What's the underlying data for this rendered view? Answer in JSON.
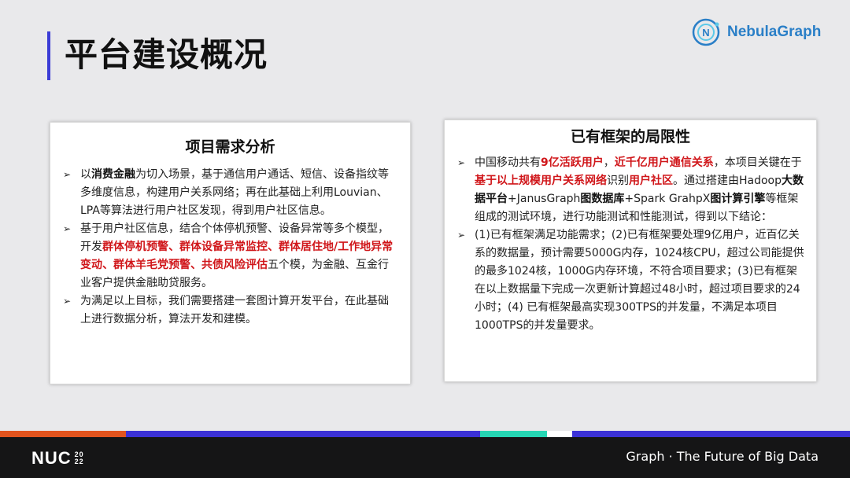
{
  "header": {
    "title": "平台建设概况"
  },
  "logo": {
    "text": "NebulaGraph",
    "icon": "nebula-logo-icon",
    "color": "#2a7fc7"
  },
  "left_panel": {
    "title": "项目需求分析",
    "items": [
      {
        "segments": [
          {
            "text": "以",
            "style": "normal"
          },
          {
            "text": "消费金融",
            "style": "bold"
          },
          {
            "text": "为切入场景，基于通信用户通话、短信、设备指纹等多维度信息，构建用户关系网络；再在此基础上利用Louvian、LPA等算法进行用户社区发现，得到用户社区信息。",
            "style": "normal"
          }
        ]
      },
      {
        "segments": [
          {
            "text": "基于用户社区信息，结合个体停机预警、设备异常等多个模型，开发",
            "style": "normal"
          },
          {
            "text": "群体停机预警、群体设备异常监控、群体居住地/工作地异常变动、群体羊毛党预警、共债风险评估",
            "style": "red"
          },
          {
            "text": "五个模，为金融、互金行业客户提供金融助贷服务。",
            "style": "normal"
          }
        ]
      },
      {
        "segments": [
          {
            "text": "为满足以上目标，我们需要搭建一套图计算开发平台，在此基础上进行数据分析，算法开发和建模。",
            "style": "normal"
          }
        ]
      }
    ]
  },
  "right_panel": {
    "title": "已有框架的局限性",
    "items": [
      {
        "segments": [
          {
            "text": "中国移动共有",
            "style": "normal"
          },
          {
            "text": "9亿活跃用户",
            "style": "red"
          },
          {
            "text": "，",
            "style": "normal"
          },
          {
            "text": "近千亿用户通信关系",
            "style": "red"
          },
          {
            "text": "，本项目关键在于",
            "style": "normal"
          },
          {
            "text": "基于以上规模用户关系网络",
            "style": "red"
          },
          {
            "text": "识别",
            "style": "normal"
          },
          {
            "text": "用户社区",
            "style": "red"
          },
          {
            "text": "。通过搭建由Hadoop",
            "style": "normal"
          },
          {
            "text": "大数据平台",
            "style": "bold"
          },
          {
            "text": "+JanusGraph",
            "style": "normal"
          },
          {
            "text": "图数据库",
            "style": "bold"
          },
          {
            "text": "+Spark GrahpX",
            "style": "normal"
          },
          {
            "text": "图计算引擎",
            "style": "bold"
          },
          {
            "text": "等框架组成的测试环境，进行功能测试和性能测试，得到以下结论：",
            "style": "normal"
          }
        ]
      },
      {
        "segments": [
          {
            "text": "(1)已有框架满足功能需求；(2)已有框架要处理9亿用户，近百亿关系的数据量，预计需要5000G内存，1024核CPU，超过公司能提供的最多1024核，1000G内存环境，不符合项目要求；(3)已有框架在以上数据量下完成一次更新计算超过48小时，超过项目要求的24小时；(4) 已有框架最高实现300TPS的并发量，不满足本项目1000TPS的并发量要求。",
            "style": "normal"
          }
        ]
      }
    ]
  },
  "footer": {
    "brand": "NUC",
    "year_top": "20",
    "year_bottom": "22",
    "tagline": "Graph · The Future of Big Data",
    "stripe_colors": [
      "#e2541e",
      "#3b31d6",
      "#26d6b4",
      "#ffffff",
      "#3b31d6"
    ]
  }
}
